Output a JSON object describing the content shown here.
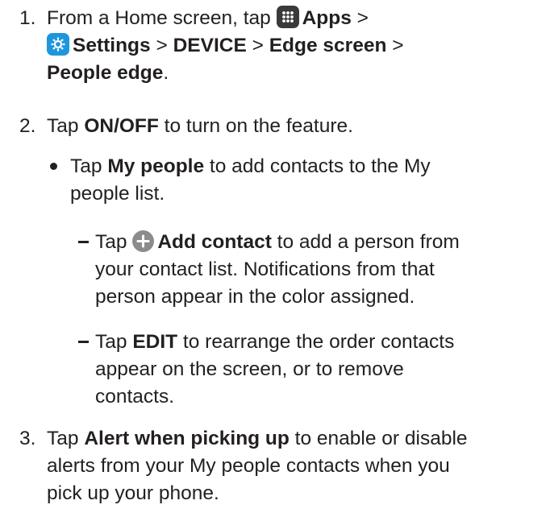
{
  "step1": {
    "number": "1.",
    "text_a": "From a Home screen, tap ",
    "apps": "Apps",
    "sep1": " >",
    "settings": "Settings",
    "sep2": " > ",
    "device": "DEVICE",
    "sep3": " > ",
    "edge_screen": "Edge screen",
    "sep4": " >",
    "people_edge": "People edge",
    "end": ".",
    "icons": [
      "apps-grid-icon",
      "settings-gear-icon"
    ]
  },
  "step2": {
    "number": "2.",
    "text_a": "Tap ",
    "onoff": "ON/OFF",
    "text_b": " to turn on the feature."
  },
  "bullet": {
    "text_a": "Tap ",
    "my_people": "My people",
    "text_b": " to add contacts to the My",
    "text_c": "people list."
  },
  "sub1": {
    "text_a": "Tap ",
    "add_contact": "Add contact",
    "text_b": " to add a person from",
    "line2": "your contact list. Notifications from that",
    "line3": "person appear in the color assigned.",
    "icon": "add-circle-icon"
  },
  "sub2": {
    "text_a": "Tap ",
    "edit": "EDIT",
    "text_b": " to rearrange the order contacts",
    "line2": "appear on the screen, or to remove",
    "line3": "contacts."
  },
  "step3": {
    "number": "3.",
    "text_a": "Tap ",
    "alert": "Alert when picking up",
    "text_b": " to enable or disable",
    "line2": "alerts from your My people contacts when you",
    "line3": "pick up your phone."
  },
  "colors": {
    "text": "#231f20",
    "settings_icon": "#1e96dc",
    "apps_icon": "#3a3a3a",
    "add_icon": "#8c8c8c"
  }
}
